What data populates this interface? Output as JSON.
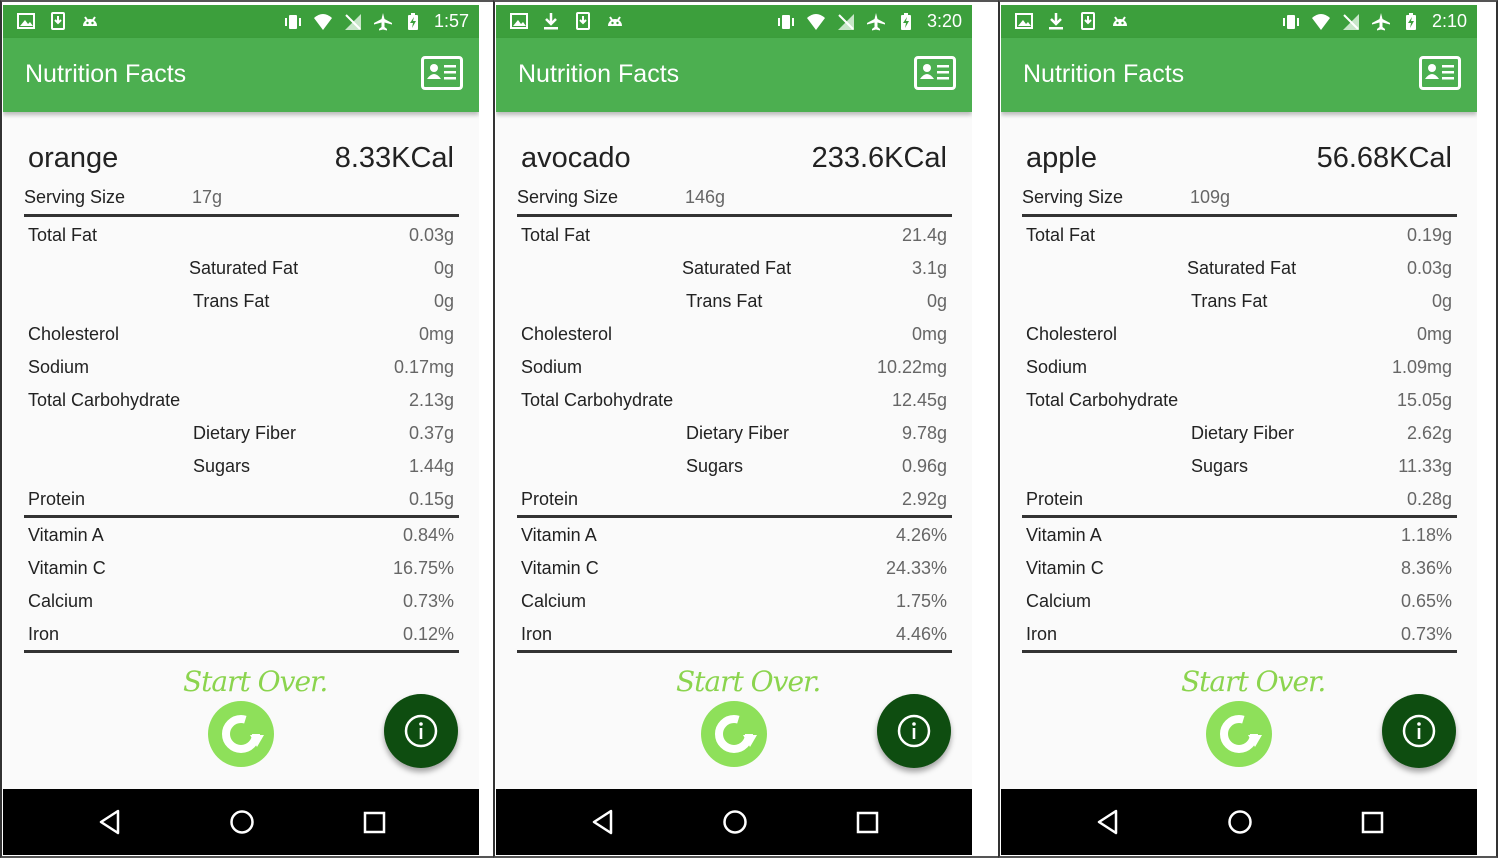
{
  "app_title": "Nutrition Facts",
  "colors": {
    "status_bar": "#3c9f3c",
    "app_bar": "#4caf50",
    "start_over": "#8bd44e",
    "refresh_button": "#8ee05a",
    "info_button": "#0e4d10"
  },
  "serving_label": "Serving Size",
  "start_over_label": "Start Over.",
  "screens": [
    {
      "time": "1:57",
      "food": "orange",
      "kcal": "8.33KCal",
      "serving": "17g",
      "rows": [
        {
          "label": "Total Fat",
          "value": "0.03g"
        },
        {
          "label": "Saturated Fat",
          "value": "0g"
        },
        {
          "label": "Trans Fat",
          "value": "0g"
        },
        {
          "label": "Cholesterol",
          "value": "0mg"
        },
        {
          "label": "Sodium",
          "value": "0.17mg"
        },
        {
          "label": "Total Carbohydrate",
          "value": "2.13g"
        },
        {
          "label": "Dietary Fiber",
          "value": "0.37g"
        },
        {
          "label": "Sugars",
          "value": "1.44g"
        },
        {
          "label": "Protein",
          "value": "0.15g"
        },
        {
          "label": "Vitamin A",
          "value": "0.84%"
        },
        {
          "label": "Vitamin C",
          "value": "16.75%"
        },
        {
          "label": "Calcium",
          "value": "0.73%"
        },
        {
          "label": "Iron",
          "value": "0.12%"
        }
      ]
    },
    {
      "time": "3:20",
      "food": "avocado",
      "kcal": "233.6KCal",
      "serving": "146g",
      "rows": [
        {
          "label": "Total Fat",
          "value": "21.4g"
        },
        {
          "label": "Saturated Fat",
          "value": "3.1g"
        },
        {
          "label": "Trans Fat",
          "value": "0g"
        },
        {
          "label": "Cholesterol",
          "value": "0mg"
        },
        {
          "label": "Sodium",
          "value": "10.22mg"
        },
        {
          "label": "Total Carbohydrate",
          "value": "12.45g"
        },
        {
          "label": "Dietary Fiber",
          "value": "9.78g"
        },
        {
          "label": "Sugars",
          "value": "0.96g"
        },
        {
          "label": "Protein",
          "value": "2.92g"
        },
        {
          "label": "Vitamin A",
          "value": "4.26%"
        },
        {
          "label": "Vitamin C",
          "value": "24.33%"
        },
        {
          "label": "Calcium",
          "value": "1.75%"
        },
        {
          "label": "Iron",
          "value": "4.46%"
        }
      ]
    },
    {
      "time": "2:10",
      "food": "apple",
      "kcal": "56.68KCal",
      "serving": "109g",
      "rows": [
        {
          "label": "Total Fat",
          "value": "0.19g"
        },
        {
          "label": "Saturated Fat",
          "value": "0.03g"
        },
        {
          "label": "Trans Fat",
          "value": "0g"
        },
        {
          "label": "Cholesterol",
          "value": "0mg"
        },
        {
          "label": "Sodium",
          "value": "1.09mg"
        },
        {
          "label": "Total Carbohydrate",
          "value": "15.05g"
        },
        {
          "label": "Dietary Fiber",
          "value": "2.62g"
        },
        {
          "label": "Sugars",
          "value": "11.33g"
        },
        {
          "label": "Protein",
          "value": "0.28g"
        },
        {
          "label": "Vitamin A",
          "value": "1.18%"
        },
        {
          "label": "Vitamin C",
          "value": "8.36%"
        },
        {
          "label": "Calcium",
          "value": "0.65%"
        },
        {
          "label": "Iron",
          "value": "0.73%"
        }
      ]
    }
  ]
}
